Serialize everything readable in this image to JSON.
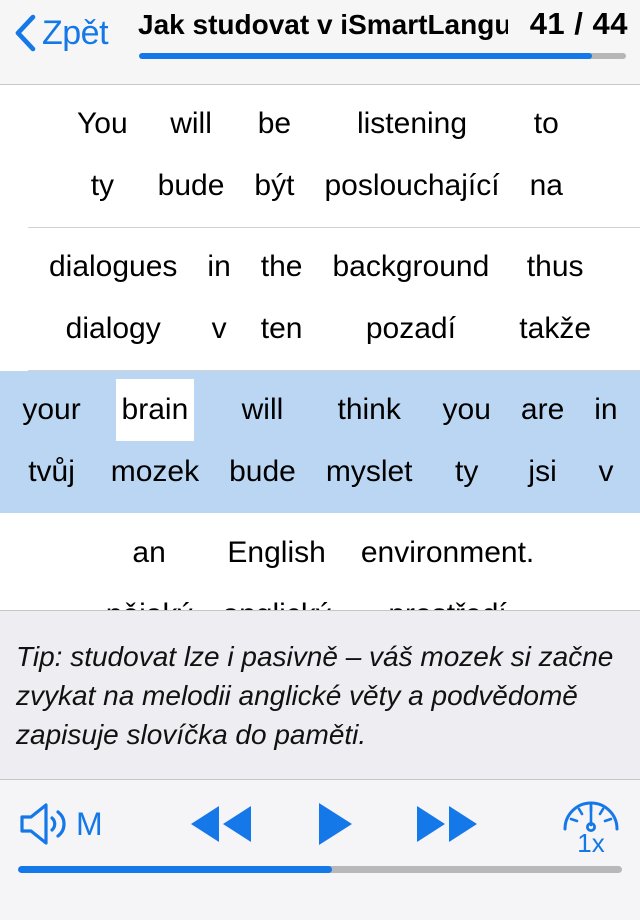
{
  "navbar": {
    "back_label": "Zpět",
    "back_icon": "chevron-left-icon",
    "title": "Jak studovat v iSmartLangu...",
    "counter": "41 / 44",
    "progress_percent": 93
  },
  "colors": {
    "accent": "#1578e8",
    "highlight_row": "#bad6f2",
    "active_word_bg": "#ffffff",
    "tip_bg": "#eeeef2",
    "toolbar_bg": "#f5f5f7",
    "navbar_bg": "#f6f6f6",
    "track": "#b8b8b8"
  },
  "lesson": {
    "rows": [
      {
        "highlighted": false,
        "pairs": [
          {
            "source": "You",
            "target": "ty",
            "active": false
          },
          {
            "source": "will",
            "target": "bude",
            "active": false
          },
          {
            "source": "be",
            "target": "být",
            "active": false
          },
          {
            "source": "listening",
            "target": "poslouchající",
            "active": false
          },
          {
            "source": "to",
            "target": "na",
            "active": false
          }
        ]
      },
      {
        "highlighted": false,
        "pairs": [
          {
            "source": "dialogues",
            "target": "dialogy",
            "active": false
          },
          {
            "source": "in",
            "target": "v",
            "active": false
          },
          {
            "source": "the",
            "target": "ten",
            "active": false
          },
          {
            "source": "background",
            "target": "pozadí",
            "active": false
          },
          {
            "source": "thus",
            "target": "takže",
            "active": false
          }
        ]
      },
      {
        "highlighted": true,
        "pairs": [
          {
            "source": "your",
            "target": "tvůj",
            "active": false
          },
          {
            "source": "brain",
            "target": "mozek",
            "active": true
          },
          {
            "source": "will",
            "target": "bude",
            "active": false
          },
          {
            "source": "think",
            "target": "myslet",
            "active": false
          },
          {
            "source": "you",
            "target": "ty",
            "active": false
          },
          {
            "source": "are",
            "target": "jsi",
            "active": false
          },
          {
            "source": "in",
            "target": "v",
            "active": false
          }
        ]
      },
      {
        "highlighted": false,
        "pairs": [
          {
            "source": "an",
            "target": "nějaký",
            "active": false
          },
          {
            "source": "English",
            "target": "anglický",
            "active": false
          },
          {
            "source": "environment.",
            "target": "prostředí",
            "active": false
          }
        ]
      }
    ]
  },
  "tip": {
    "text": "Tip: studovat lze i pasivně – váš mozek si začne zvykat na melodii anglické věty a podvědomě zapisuje slovíčka do paměti."
  },
  "toolbar": {
    "audio_mode_label": "M",
    "audio_icon": "speaker-wave-icon",
    "rewind_icon": "rewind-icon",
    "play_icon": "play-icon",
    "forward_icon": "fast-forward-icon",
    "speed_icon": "speedometer-icon",
    "speed_label": "1x",
    "scrubber_percent": 52
  }
}
